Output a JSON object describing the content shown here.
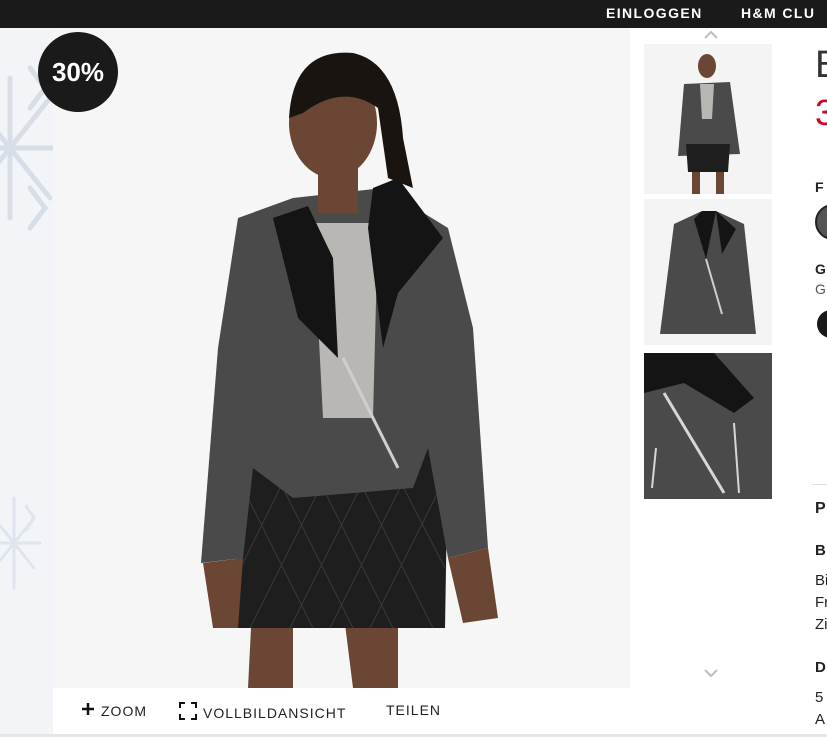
{
  "nav": {
    "login": "EINLOGGEN",
    "club": "H&M CLU"
  },
  "badge": {
    "discount": "30%"
  },
  "toolbar": {
    "zoom": "ZOOM",
    "fullscreen": "VOLLBILDANSICHT",
    "share": "TEILEN"
  },
  "product": {
    "title_fragment": "B",
    "price_fragment": "3",
    "color_label_fragment": "F",
    "size_label_fragment": "G",
    "size_value_fragment": "G",
    "section_p": "P",
    "section_b": "B",
    "desc_line1": "Bi",
    "desc_line2": "Fr",
    "desc_line3": "Zi",
    "section_d": "D",
    "detail_line1": "5",
    "detail_line2": "A"
  },
  "colors": {
    "accent_price": "#cc071e",
    "dark": "#1a1a1a",
    "bg": "#ffffff"
  },
  "icons": [
    "plus-icon",
    "fullscreen-icon",
    "chevron-up-icon",
    "chevron-down-icon",
    "snowflake-icon"
  ]
}
